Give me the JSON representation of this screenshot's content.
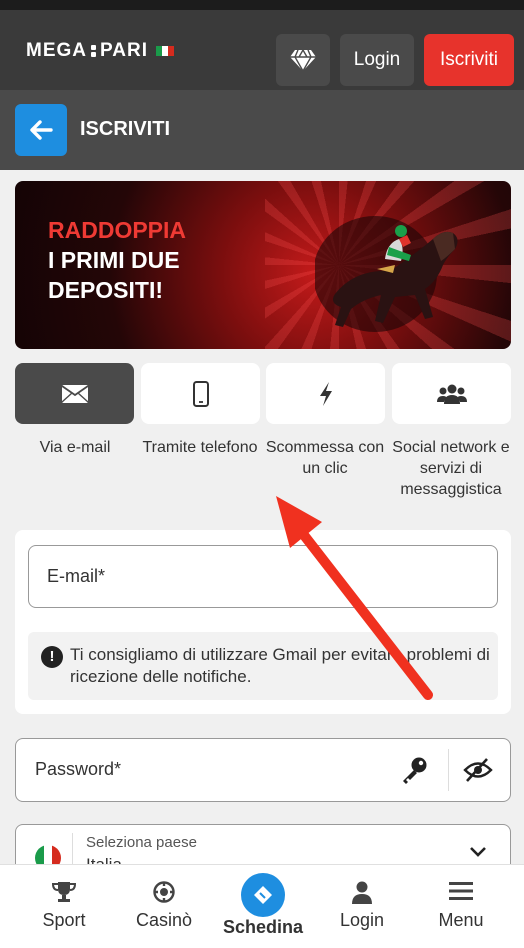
{
  "header": {
    "logo": "MEGA PARI",
    "login": "Login",
    "signup": "Iscriviti",
    "colors": {
      "bg": "#3a3a3a",
      "signup": "#e7332c"
    }
  },
  "subheader": {
    "title": "ISCRIVITI",
    "back_icon": "arrow-left-icon"
  },
  "banner": {
    "line1": "RADDOPPIA",
    "line2": "I PRIMI DUE",
    "line3": "DEPOSITI!"
  },
  "methods": [
    {
      "icon": "envelope-icon",
      "label": "Via e-mail",
      "active": true
    },
    {
      "icon": "phone-icon",
      "label": "Tramite telefono",
      "active": false
    },
    {
      "icon": "lightning-icon",
      "label": "Scommessa con un clic",
      "active": false
    },
    {
      "icon": "users-icon",
      "label": "Social network e servizi di messaggistica",
      "active": false
    }
  ],
  "form": {
    "email_placeholder": "E-mail*",
    "notice": "Ti consigliamo di utilizzare Gmail per evitare problemi di ricezione delle notifiche.",
    "password_placeholder": "Password*",
    "country_label": "Seleziona paese",
    "country_value": "Italia"
  },
  "bottom_nav": [
    {
      "icon": "trophy-icon",
      "label": "Sport"
    },
    {
      "icon": "chip-icon",
      "label": "Casinò"
    },
    {
      "icon": "ticket-icon",
      "label": "Schedina",
      "active": true
    },
    {
      "icon": "user-icon",
      "label": "Login"
    },
    {
      "icon": "menu-icon",
      "label": "Menu"
    }
  ],
  "annotation": {
    "arrow_color": "#f0311f"
  }
}
